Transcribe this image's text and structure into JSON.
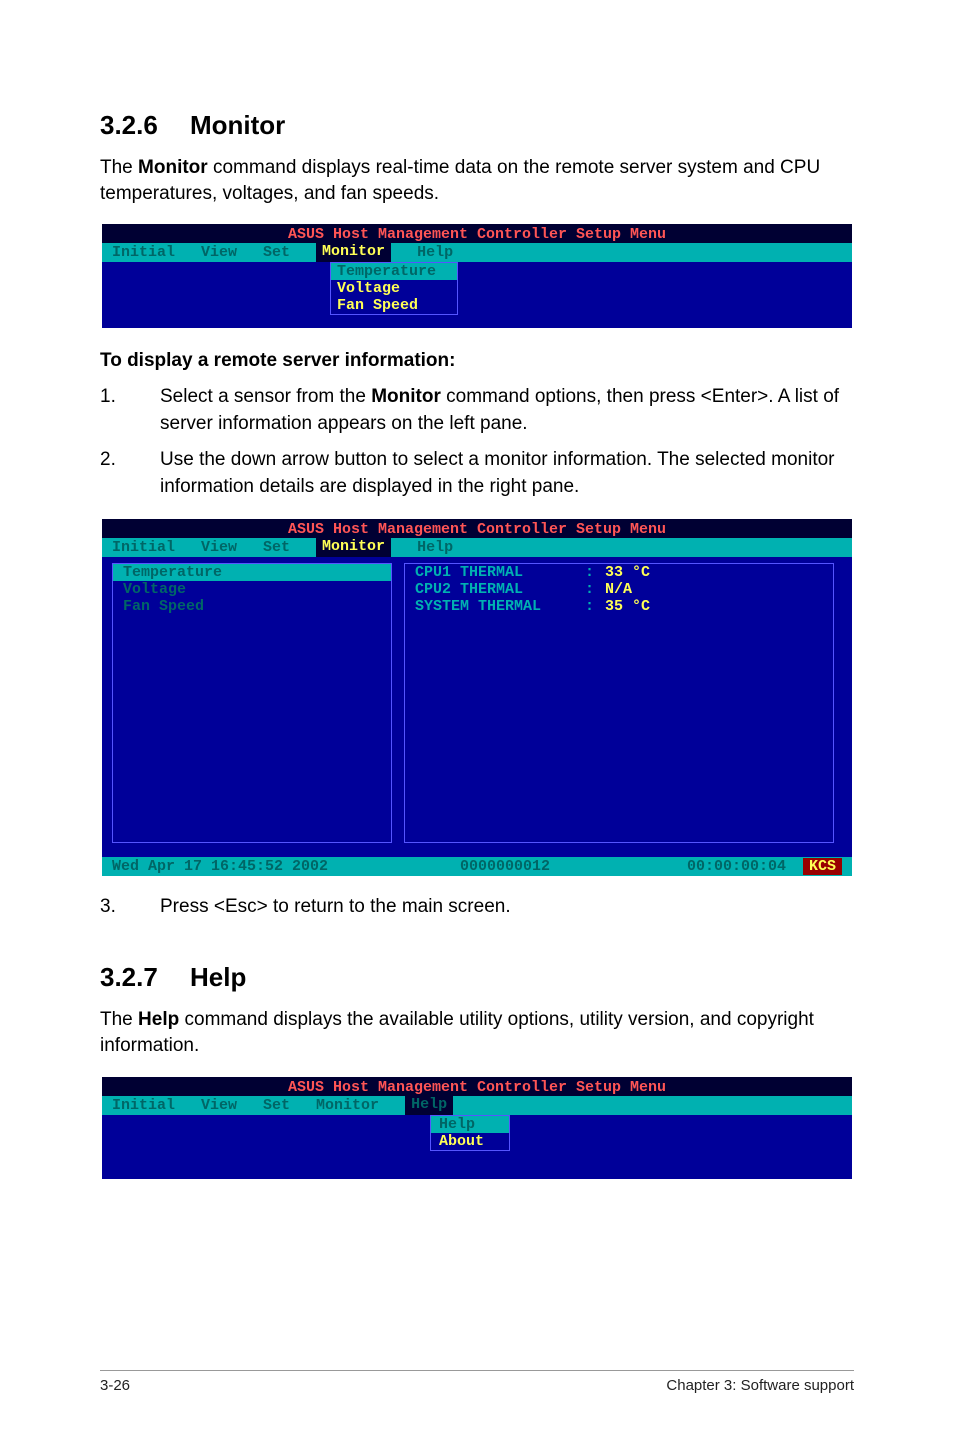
{
  "section_monitor": {
    "num": "3.2.6",
    "title": "Monitor"
  },
  "monitor_para_prefix": "The ",
  "monitor_para_bold": "Monitor",
  "monitor_para_suffix": " command displays real-time data on the remote server system and CPU temperatures, voltages, and fan speeds.",
  "ss_title": "ASUS Host Management Controller Setup Menu",
  "menubar": {
    "initial": "Initial",
    "view": "View",
    "set": "Set",
    "monitor": "Monitor",
    "help": "Help"
  },
  "monitor_dropdown": {
    "temperature": "Temperature",
    "voltage": "Voltage",
    "fan": "Fan Speed"
  },
  "subhead": "To display a remote server information:",
  "step1_a": "Select a sensor from the ",
  "step1_bold": "Monitor",
  "step1_b": " command options, then press <Enter>. A list of server information appears on the left pane.",
  "step2": "Use the down arrow button to select a monitor information. The selected monitor information details are displayed in the right pane.",
  "chart_data": {
    "type": "table",
    "title": "Monitor > Temperature readings",
    "rows": [
      {
        "label": "CPU1 THERMAL",
        "value": "33 °C"
      },
      {
        "label": "CPU2 THERMAL",
        "value": "N/A"
      },
      {
        "label": "SYSTEM THERMAL",
        "value": "35 °C"
      }
    ]
  },
  "left_pane": {
    "temperature": "Temperature",
    "voltage": "Voltage",
    "fan": "Fan Speed"
  },
  "statusbar": {
    "date": "Wed Apr 17 16:45:52 2002",
    "code": "0000000012",
    "addr": "00:00:00:04",
    "mode": "KCS"
  },
  "step3": "Press <Esc> to return to the main screen.",
  "section_help": {
    "num": "3.2.7",
    "title": "Help"
  },
  "help_para_prefix": "The ",
  "help_para_bold": "Help",
  "help_para_suffix": " command displays the available utility options, utility version, and copyright information.",
  "help_dropdown": {
    "help": "Help",
    "about": "About"
  },
  "footer": {
    "left": "3-26",
    "right": "Chapter 3: Software support"
  }
}
